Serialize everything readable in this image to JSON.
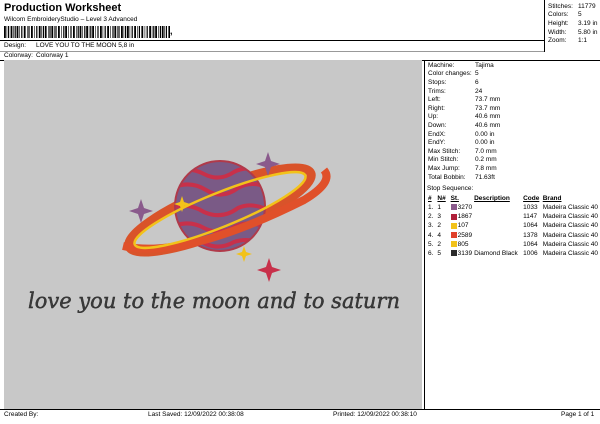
{
  "header": {
    "title": "Production Worksheet",
    "subtitle": "Wilcom EmbroideryStudio – Level 3 Advanced",
    "barcode_suffix": ","
  },
  "design_info": {
    "design_label": "Design:",
    "design_value": "LOVE YOU TO THE MOON 5,8 in",
    "colorway_label": "Colorway:",
    "colorway_value": "Colorway 1"
  },
  "summary": [
    {
      "label": "Stitches:",
      "value": "11779"
    },
    {
      "label": "Colors:",
      "value": "5"
    },
    {
      "label": "Height:",
      "value": "3.19 in"
    },
    {
      "label": "Width:",
      "value": "5.80 in"
    },
    {
      "label": "Zoom:",
      "value": "1:1"
    }
  ],
  "machine_info": [
    {
      "label": "Machine:",
      "value": "Tajima"
    },
    {
      "label": "Color changes:",
      "value": "5"
    },
    {
      "label": "Stops:",
      "value": "6"
    },
    {
      "label": "Trims:",
      "value": "24"
    },
    {
      "label": "Left:",
      "value": "73.7 mm"
    },
    {
      "label": "Right:",
      "value": "73.7 mm"
    },
    {
      "label": "Up:",
      "value": "40.6 mm"
    },
    {
      "label": "Down:",
      "value": "40.6 mm"
    },
    {
      "label": "EndX:",
      "value": "0.00 in"
    },
    {
      "label": "EndY:",
      "value": "0.00 in"
    },
    {
      "label": "Max Stitch:",
      "value": "7.0 mm"
    },
    {
      "label": "Min Stitch:",
      "value": "0.2 mm"
    },
    {
      "label": "Max Jump:",
      "value": "7.8 mm"
    },
    {
      "label": "Total Bobbin:",
      "value": "71.63ft"
    }
  ],
  "stop_sequence": {
    "title": "Stop Sequence:",
    "headers": [
      "#",
      "N#",
      "St.",
      "Description",
      "Code",
      "Brand"
    ],
    "rows": [
      {
        "num": "1.",
        "n": "1",
        "color": "#8a5a8c",
        "st": "3270",
        "desc": "",
        "code": "1033",
        "brand": "Madeira Classic 40"
      },
      {
        "num": "2.",
        "n": "3",
        "color": "#b0203a",
        "st": "1867",
        "desc": "",
        "code": "1147",
        "brand": "Madeira Classic 40"
      },
      {
        "num": "3.",
        "n": "2",
        "color": "#f2c21a",
        "st": "107",
        "desc": "",
        "code": "1064",
        "brand": "Madeira Classic 40"
      },
      {
        "num": "4.",
        "n": "4",
        "color": "#e0402a",
        "st": "2589",
        "desc": "",
        "code": "1378",
        "brand": "Madeira Classic 40"
      },
      {
        "num": "5.",
        "n": "2",
        "color": "#f2c21a",
        "st": "805",
        "desc": "",
        "code": "1064",
        "brand": "Madeira Classic 40"
      },
      {
        "num": "6.",
        "n": "5",
        "color": "#2a2a2a",
        "st": "3139",
        "desc": "Diamond Black",
        "code": "1006",
        "brand": "Madeira Classic 40"
      }
    ]
  },
  "design_text": "love you to the moon and to saturn",
  "footer": {
    "created_by": "Created By:",
    "last_saved": "Last Saved: 12/09/2022 00:38:08",
    "printed": "Printed: 12/09/2022 00:38:10",
    "page": "Page 1 of 1"
  }
}
